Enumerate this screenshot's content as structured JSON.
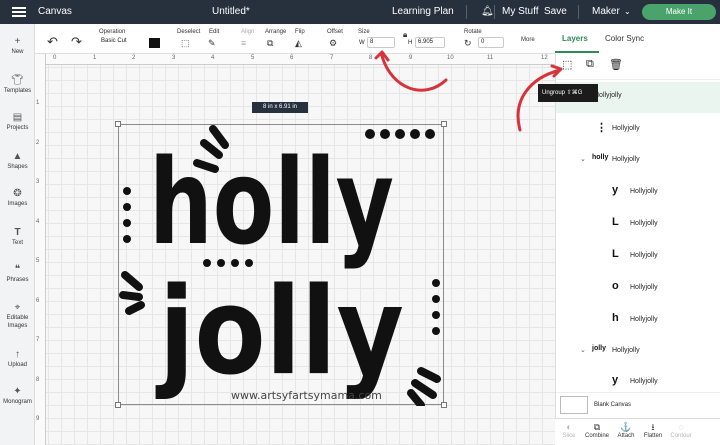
{
  "topbar": {
    "title": "Canvas",
    "doc_title": "Untitled*",
    "learning_plan": "Learning Plan",
    "my_stuff": "My Stuff",
    "save": "Save",
    "machine": "Maker",
    "make_it": "Make It"
  },
  "toolbar": {
    "operation_label": "Operation",
    "operation_value": "Basic Cut",
    "deselect": "Deselect",
    "edit": "Edit",
    "align": "Align",
    "arrange": "Arrange",
    "flip": "Flip",
    "offset": "Offset",
    "size": "Size",
    "w_label": "W",
    "w_value": "8",
    "h_label": "H",
    "h_value": "6.905",
    "rotate": "Rotate",
    "rotate_value": "0",
    "more": "More"
  },
  "tabs": {
    "layers": "Layers",
    "color_sync": "Color Sync"
  },
  "sidebar": {
    "items": [
      {
        "label": "New",
        "icon": "plus-icon"
      },
      {
        "label": "Templates",
        "icon": "shirt-icon"
      },
      {
        "label": "Projects",
        "icon": "projects-icon"
      },
      {
        "label": "Shapes",
        "icon": "shapes-icon"
      },
      {
        "label": "Images",
        "icon": "lightbulb-icon"
      },
      {
        "label": "Text",
        "icon": "text-icon"
      },
      {
        "label": "Phrases",
        "icon": "phrases-icon"
      },
      {
        "label": "Editable Images",
        "icon": "editable-images-icon"
      },
      {
        "label": "Upload",
        "icon": "upload-icon"
      },
      {
        "label": "Monogram",
        "icon": "monogram-icon"
      }
    ]
  },
  "ruler": {
    "top": [
      "0",
      "1",
      "2",
      "3",
      "4",
      "5",
      "6",
      "7",
      "8",
      "9",
      "10",
      "11",
      "12"
    ],
    "left": [
      "1",
      "2",
      "3",
      "4",
      "5",
      "6",
      "7",
      "8",
      "9"
    ]
  },
  "canvas": {
    "size_tooltip": "8  in x 6.91  in",
    "design": {
      "word1": "holly",
      "word2": "jolly",
      "watermark": "www.artsyfartsymama.com",
      "color": "#111111"
    }
  },
  "layers": {
    "ungroup_tooltip": "Ungroup ⇧⌘G",
    "top_group": "Hollyjolly",
    "rows": [
      {
        "name": "Hollyjolly",
        "thumb": "⋮",
        "indent": 2
      },
      {
        "name": "Hollyjolly",
        "thumb": "holly",
        "indent": 1,
        "chevron": true
      },
      {
        "name": "Hollyjolly",
        "thumb": "y",
        "indent": 3
      },
      {
        "name": "Hollyjolly",
        "thumb": "L",
        "indent": 3
      },
      {
        "name": "Hollyjolly",
        "thumb": "L",
        "indent": 3
      },
      {
        "name": "Hollyjolly",
        "thumb": "o",
        "indent": 3
      },
      {
        "name": "Hollyjolly",
        "thumb": "h",
        "indent": 3
      },
      {
        "name": "Hollyjolly",
        "thumb": "jolly",
        "indent": 1,
        "chevron": true
      },
      {
        "name": "Hollyjolly",
        "thumb": "y",
        "indent": 3
      }
    ],
    "blank_canvas": "Blank Canvas"
  },
  "bottombar": {
    "slice": "Slice",
    "combine": "Combine",
    "attach": "Attach",
    "flatten": "Flatten",
    "contour": "Contour"
  },
  "colors": {
    "topbar": "#26313d",
    "make_it": "#4aa36b",
    "annotation": "#d8323a",
    "selected_layer": "#eaf5ef"
  }
}
